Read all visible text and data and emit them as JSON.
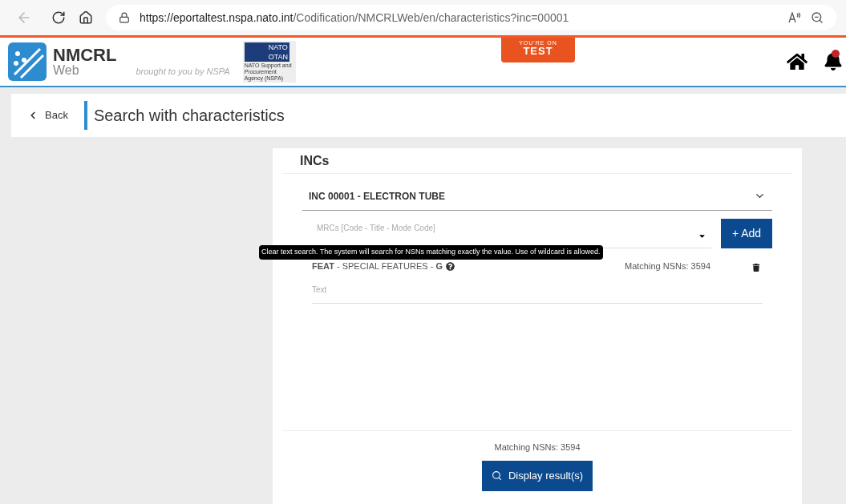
{
  "browser": {
    "url_host": "https://eportaltest.nspa.nato.int",
    "url_path": "/Codification/NMCRLWeb/en/characteristics?inc=00001"
  },
  "header": {
    "app_name": "NMCRL",
    "app_sub": "Web",
    "tagline": "brought to you by NSPA",
    "nato_en": "NATO",
    "nato_fr": "OTAN",
    "agency": "NATO Support and Procurement Agency (NSPA)",
    "env_top": "YOU'RE ON",
    "env_name": "TEST"
  },
  "page": {
    "back": "Back",
    "title": "Search with characteristics"
  },
  "card": {
    "heading": "INCs",
    "inc": {
      "label": "INC 00001 - ELECTRON TUBE",
      "expanded": true
    },
    "mrc": {
      "placeholder": "MRCs [Code - Title - Mode Code]"
    },
    "add_button": "+ Add",
    "tooltip": "Clear text search. The system will search for NSNs matching exactly the value. Use of wildcard is allowed.",
    "criteria": [
      {
        "label": "**FEAT** - SPECIAL FEATURES - **G**",
        "matching": "Matching NSNs: 3594",
        "placeholder": "Text"
      }
    ],
    "footer_matching": "Matching NSNs: 3594",
    "display_button": "Display result(s)"
  }
}
